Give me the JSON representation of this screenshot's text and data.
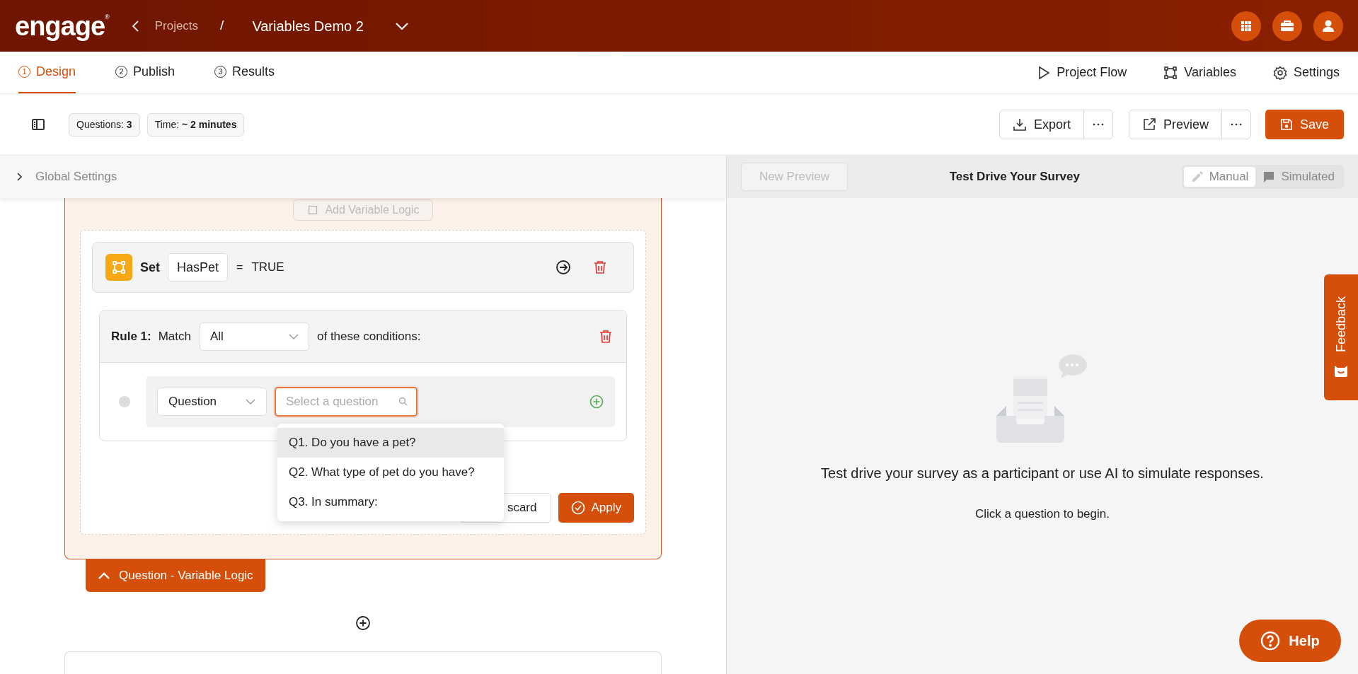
{
  "header": {
    "logo": "engage",
    "logo_mark": "®",
    "breadcrumb": "Projects",
    "separator": "/",
    "project": "Variables Demo 2"
  },
  "tabs": [
    {
      "step": "1",
      "label": "Design",
      "selected": true
    },
    {
      "step": "2",
      "label": "Publish",
      "selected": false
    },
    {
      "step": "3",
      "label": "Results",
      "selected": false
    }
  ],
  "nav_links": [
    {
      "kind": "flow",
      "label": "Project Flow"
    },
    {
      "kind": "variables",
      "label": "Variables"
    },
    {
      "kind": "settings",
      "label": "Settings"
    }
  ],
  "stats": [
    {
      "label": "Questions:",
      "value": "3"
    },
    {
      "label": "Time:",
      "value": "~ 2 minutes"
    }
  ],
  "actions": {
    "export": "Export",
    "preview": "Preview",
    "save": "Save"
  },
  "global_settings": "Global Settings",
  "add_logic_button": "Add Variable Logic",
  "set_row": {
    "keyword": "Set",
    "variable": "HasPet",
    "operator": "=",
    "value": "TRUE"
  },
  "rule": {
    "label": "Rule 1:",
    "match_label": "Match",
    "match_value": "All",
    "suffix": "of these conditions:"
  },
  "condition": {
    "type": "Question",
    "search_placeholder": "Select a question"
  },
  "question_menu": [
    {
      "label": "Q1. Do you have a pet?",
      "highlighted": true
    },
    {
      "label": "Q2. What type of pet do you have?",
      "highlighted": false
    },
    {
      "label": "Q3. In summary:",
      "highlighted": false
    }
  ],
  "buttons": {
    "discard": "scard",
    "apply": "Apply"
  },
  "section_tab": "Question - Variable Logic",
  "preview": {
    "new_button": "New Preview",
    "title": "Test Drive Your Survey",
    "modes": [
      {
        "kind": "manual",
        "label": "Manual",
        "selected": true
      },
      {
        "kind": "simulated",
        "label": "Simulated",
        "selected": false
      }
    ],
    "message": "Test drive your survey as a participant or use AI to simulate responses.",
    "hint": "Click a question to begin."
  },
  "feedback": "Feedback",
  "help": "Help"
}
